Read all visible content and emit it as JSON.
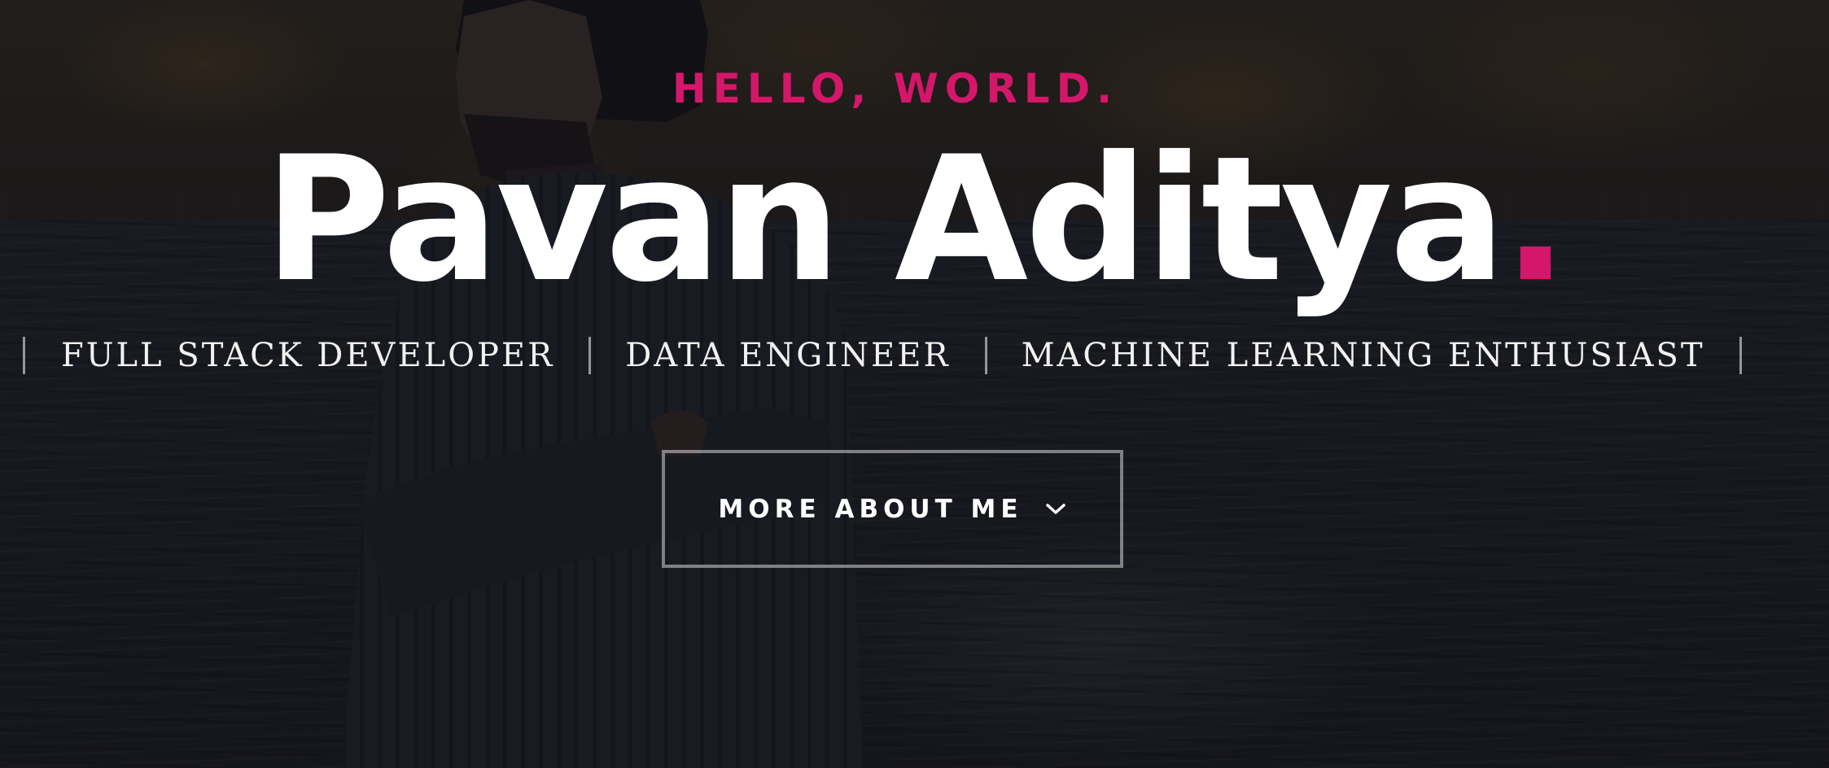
{
  "hero": {
    "greeting": "HELLO, WORLD.",
    "name": "Pavan Aditya",
    "name_punctuation": ".",
    "roles": [
      "FULL STACK DEVELOPER",
      "DATA ENGINEER",
      "MACHINE LEARNING ENTHUSIAST"
    ],
    "cta_label": "MORE ABOUT ME",
    "cta_icon": "chevron-down-icon"
  },
  "colors": {
    "accent": "#d4176a",
    "text": "#ffffff",
    "overlay": "#0e0f14"
  }
}
